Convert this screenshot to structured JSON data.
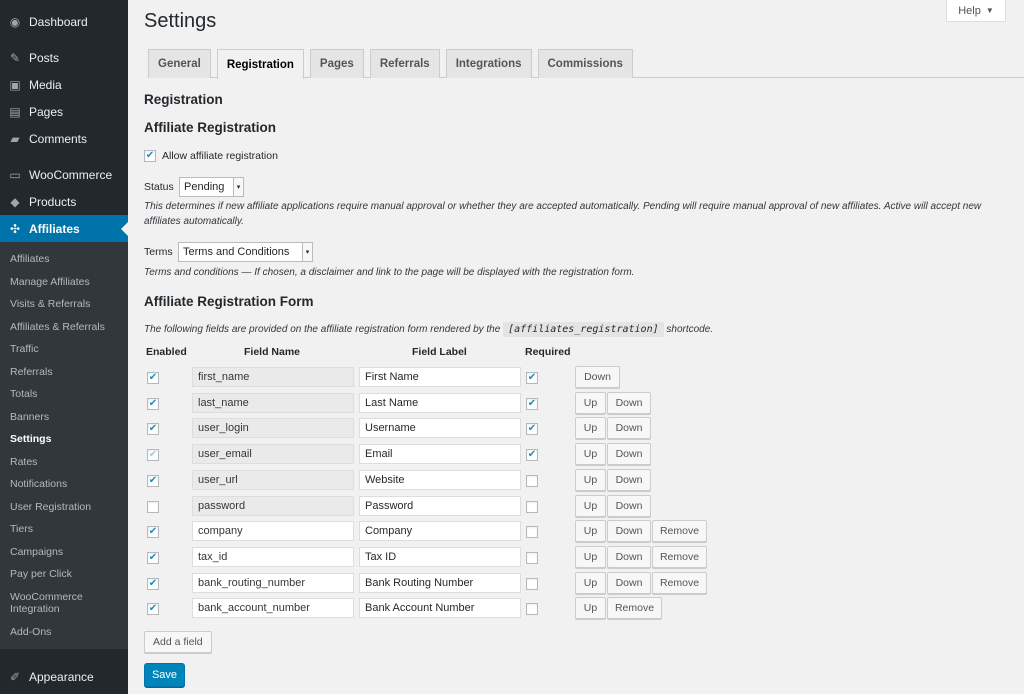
{
  "sidebar": {
    "top": [
      {
        "label": "Dashboard",
        "icon": "dashboard-icon"
      },
      {
        "label": "Posts",
        "icon": "pin-icon"
      },
      {
        "label": "Media",
        "icon": "media-icon"
      },
      {
        "label": "Pages",
        "icon": "pages-icon"
      },
      {
        "label": "Comments",
        "icon": "comments-icon"
      },
      {
        "label": "WooCommerce",
        "icon": "woocommerce-icon"
      },
      {
        "label": "Products",
        "icon": "products-icon"
      },
      {
        "label": "Affiliates",
        "icon": "affiliates-icon"
      }
    ],
    "sub": [
      "Affiliates",
      "Manage Affiliates",
      "Visits & Referrals",
      "Affiliates & Referrals",
      "Traffic",
      "Referrals",
      "Totals",
      "Banners",
      "Settings",
      "Rates",
      "Notifications",
      "User Registration",
      "Tiers",
      "Campaigns",
      "Pay per Click",
      "WooCommerce Integration",
      "Add-Ons"
    ],
    "bottom": {
      "label": "Appearance",
      "icon": "appearance-icon"
    }
  },
  "header": {
    "title": "Settings",
    "help": "Help"
  },
  "tabs": [
    "General",
    "Registration",
    "Pages",
    "Referrals",
    "Integrations",
    "Commissions"
  ],
  "section": {
    "heading": "Registration",
    "affiliate_heading": "Affiliate Registration",
    "allow_label": "Allow affiliate registration",
    "status_label": "Status",
    "status_value": "Pending",
    "status_desc": "This determines if new affiliate applications require manual approval or whether they are accepted automatically. Pending will require manual approval of new affiliates. Active will accept new affiliates automatically.",
    "terms_label": "Terms",
    "terms_value": "Terms and Conditions",
    "terms_desc": "Terms and conditions — If chosen, a disclaimer and link to the page will be displayed with the registration form.",
    "form_heading": "Affiliate Registration Form",
    "form_desc_before": "The following fields are provided on the affiliate registration form rendered by the",
    "form_shortcode": "[affiliates_registration]",
    "form_desc_after": "shortcode."
  },
  "table": {
    "headers": {
      "enabled": "Enabled",
      "name": "Field Name",
      "label": "Field Label",
      "required": "Required"
    },
    "rows": [
      {
        "enabled": true,
        "name": "first_name",
        "label": "First Name",
        "required": true,
        "buttons": [
          "Down"
        ]
      },
      {
        "enabled": true,
        "name": "last_name",
        "label": "Last Name",
        "required": true,
        "buttons": [
          "Up",
          "Down"
        ]
      },
      {
        "enabled": true,
        "name": "user_login",
        "label": "Username",
        "required": true,
        "buttons": [
          "Up",
          "Down"
        ]
      },
      {
        "enabled": true,
        "name": "user_email",
        "label": "Email",
        "required": true,
        "buttons": [
          "Up",
          "Down"
        ]
      },
      {
        "enabled": true,
        "name": "user_url",
        "label": "Website",
        "required": false,
        "buttons": [
          "Up",
          "Down"
        ]
      },
      {
        "enabled": false,
        "name": "password",
        "label": "Password",
        "required": false,
        "buttons": [
          "Up",
          "Down"
        ]
      },
      {
        "enabled": true,
        "name": "company",
        "label": "Company",
        "required": false,
        "buttons": [
          "Up",
          "Down",
          "Remove"
        ]
      },
      {
        "enabled": true,
        "name": "tax_id",
        "label": "Tax ID",
        "required": false,
        "buttons": [
          "Up",
          "Down",
          "Remove"
        ]
      },
      {
        "enabled": true,
        "name": "bank_routing_number",
        "label": "Bank Routing Number",
        "required": false,
        "buttons": [
          "Up",
          "Down",
          "Remove"
        ]
      },
      {
        "enabled": true,
        "name": "bank_account_number",
        "label": "Bank Account Number",
        "required": false,
        "buttons": [
          "Up",
          "Remove"
        ]
      }
    ]
  },
  "actions": {
    "add_field": "Add a field",
    "save": "Save"
  },
  "colors": {
    "sidebar_bg": "#23282d",
    "submenu_bg": "#32373c",
    "accent": "#0073aa",
    "primary_button": "#0085ba"
  }
}
